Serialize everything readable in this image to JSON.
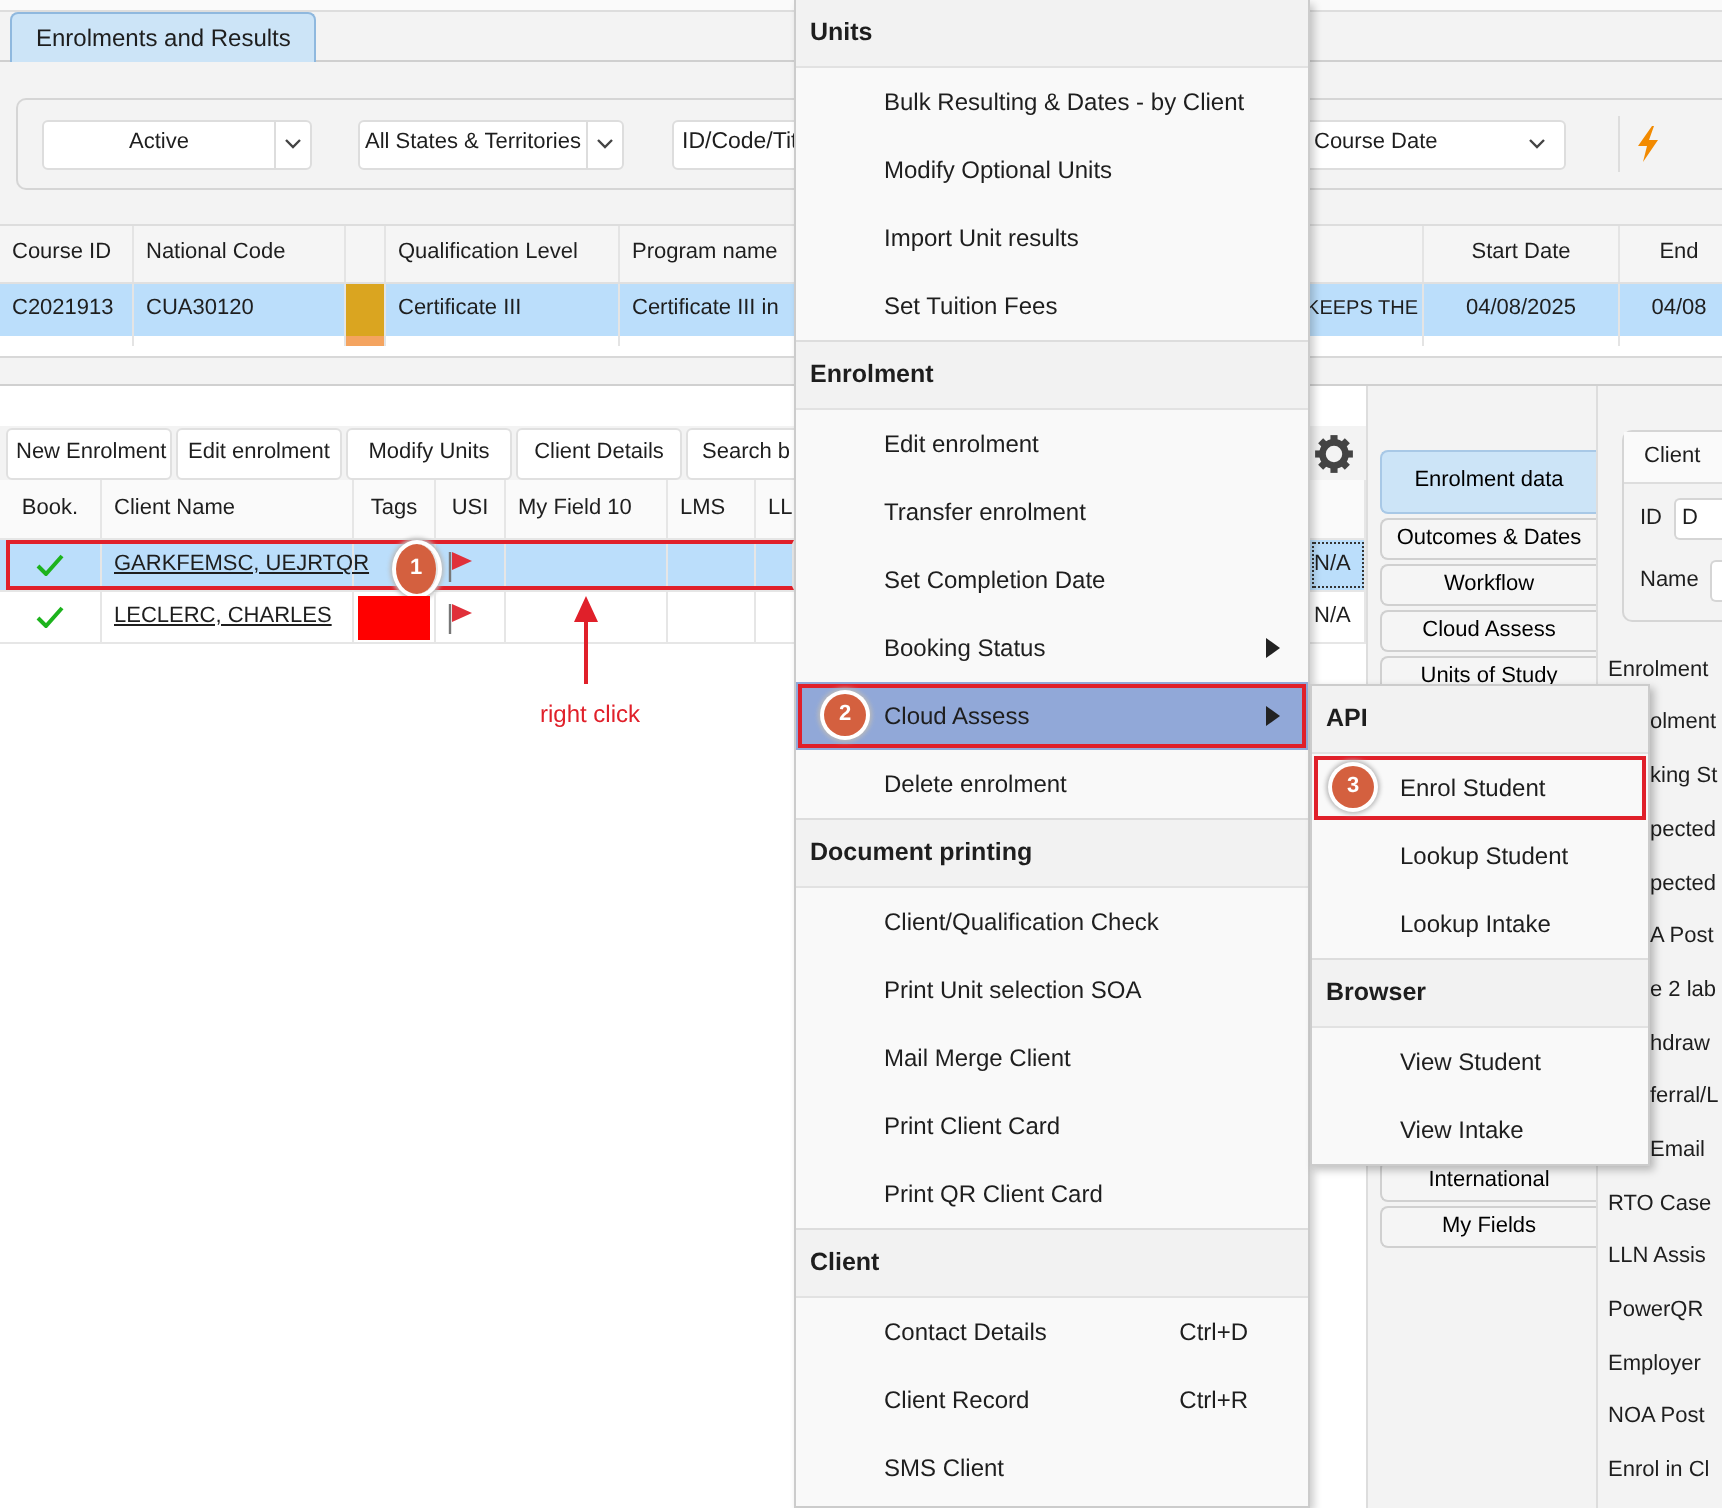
{
  "tabs": [
    {
      "label": "Enrolments and Results",
      "selected": true
    }
  ],
  "filters": [
    {
      "kind": "dropdown",
      "value": "Active"
    },
    {
      "kind": "dropdown",
      "value": "All States & Territories"
    },
    {
      "kind": "field",
      "value": "ID/Code/Tit"
    },
    {
      "kind": "dropdown",
      "value": "Course Date"
    }
  ],
  "course_table": {
    "columns": [
      {
        "kind": "text",
        "label": "Course ID"
      },
      {
        "kind": "text",
        "label": "National Code"
      },
      {
        "kind": "color"
      },
      {
        "kind": "text",
        "label": "Qualification Level"
      },
      {
        "kind": "text",
        "label": "Program name"
      },
      {
        "kind": "blank"
      },
      {
        "kind": "text",
        "label": "Start Date"
      },
      {
        "kind": "text",
        "label": "End"
      }
    ],
    "rows": [
      {
        "selected": true,
        "color": "#daa520",
        "cells": [
          "C2021913",
          "CUA30120",
          "Certificate III",
          "Certificate III in",
          "KEEPS THE",
          "04/08/2025",
          "04/08"
        ]
      },
      {
        "selected": false,
        "color": "#f4a460"
      }
    ]
  },
  "enrolment_buttons": [
    "New Enrolment",
    "Edit enrolment",
    "Modify Units",
    "Client Details",
    "Search b"
  ],
  "enrolment_grid": {
    "columns": [
      "Book.",
      "Client Name",
      "Tags",
      "USI",
      "My Field 10",
      "LMS",
      "LL"
    ],
    "rows": [
      {
        "selected": true,
        "booked": true,
        "client_name": "GARKFEMSC, UEJRTQR",
        "usi_flag": true,
        "column_8": "N/A",
        "focused": true,
        "badge": "1"
      },
      {
        "selected": false,
        "booked": true,
        "client_name": "LECLERC, CHARLES",
        "color": "#ff0000",
        "usi_flag": true,
        "column_8": "N/A",
        "focused": false
      }
    ]
  },
  "annotation": {
    "text": "right click"
  },
  "vertical_tabs": [
    {
      "label": "Enrolment data",
      "selected": true
    },
    {
      "label": "Outcomes & Dates",
      "selected": false
    },
    {
      "label": "Workflow",
      "selected": false
    },
    {
      "label": "Cloud Assess",
      "selected": false
    },
    {
      "label": "Units of Study",
      "selected": false
    },
    {
      "label": "International",
      "selected": false
    },
    {
      "label": "My Fields",
      "selected": false
    }
  ],
  "client_box": {
    "title": "Client",
    "fields": [
      {
        "label": "ID",
        "value": "D"
      },
      {
        "label": "Name"
      }
    ]
  },
  "form_labels": [
    {
      "text": "Enrolment",
      "covered": false
    },
    {
      "text": "olment",
      "covered": true
    },
    {
      "text": "king St",
      "covered": true
    },
    {
      "text": "pected",
      "covered": true
    },
    {
      "text": "pected",
      "covered": true
    },
    {
      "text": "A Post",
      "covered": true
    },
    {
      "text": "e 2 lab",
      "covered": true
    },
    {
      "text": "hdraw",
      "covered": true
    },
    {
      "text": "ferral/L",
      "covered": true
    },
    {
      "text": "Email",
      "covered": true
    },
    {
      "text": "RTO Case",
      "covered": false
    },
    {
      "text": "LLN Assis",
      "covered": false
    },
    {
      "text": "PowerQR",
      "covered": false
    },
    {
      "text": "Employer",
      "covered": false
    },
    {
      "text": "NOA Post",
      "covered": false
    },
    {
      "text": "Enrol in Cl",
      "covered": false
    }
  ],
  "context_menu": {
    "sections": [
      {
        "title": "Units",
        "items": [
          {
            "label": "Bulk Resulting & Dates - by Client",
            "selected": false
          },
          {
            "label": "Modify Optional Units",
            "selected": false
          },
          {
            "label": "Import Unit results",
            "selected": false
          },
          {
            "label": "Set Tuition Fees",
            "selected": false
          }
        ]
      },
      {
        "title": "Enrolment",
        "items": [
          {
            "label": "Edit enrolment",
            "selected": false
          },
          {
            "label": "Transfer enrolment",
            "selected": false
          },
          {
            "label": "Set Completion Date",
            "selected": false
          },
          {
            "label": "Booking Status",
            "selected": false,
            "has_submenu": true
          },
          {
            "label": "Cloud Assess",
            "selected": true,
            "has_submenu": true,
            "badge": "2"
          },
          {
            "label": "Delete enrolment",
            "selected": false
          }
        ]
      },
      {
        "title": "Document printing",
        "items": [
          {
            "label": "Client/Qualification Check",
            "selected": false
          },
          {
            "label": "Print Unit selection SOA",
            "selected": false
          },
          {
            "label": "Mail Merge Client",
            "selected": false
          },
          {
            "label": "Print Client Card",
            "selected": false
          },
          {
            "label": "Print QR Client Card",
            "selected": false
          }
        ]
      },
      {
        "title": "Client",
        "items": [
          {
            "label": "Contact Details",
            "shortcut": "Ctrl+D",
            "selected": false
          },
          {
            "label": "Client Record",
            "shortcut": "Ctrl+R",
            "selected": false
          },
          {
            "label": "SMS Client",
            "selected": false
          }
        ]
      }
    ]
  },
  "submenu": {
    "sections": [
      {
        "title": "API",
        "items": [
          {
            "label": "Enrol Student",
            "selected": false,
            "badge": "3"
          },
          {
            "label": "Lookup Student",
            "selected": false
          },
          {
            "label": "Lookup Intake",
            "selected": false
          }
        ]
      },
      {
        "title": "Browser",
        "items": [
          {
            "label": "View Student",
            "selected": false
          },
          {
            "label": "View Intake",
            "selected": false
          }
        ]
      }
    ]
  }
}
